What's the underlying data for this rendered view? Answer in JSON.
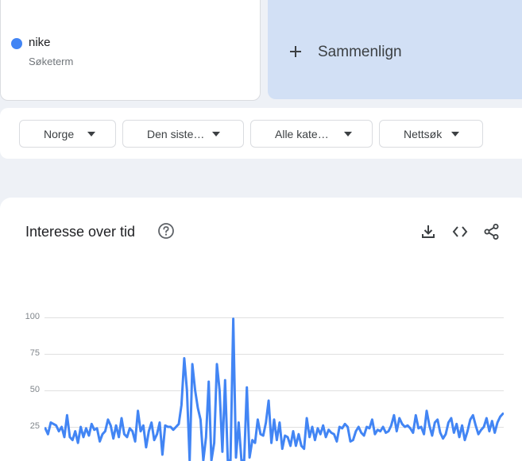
{
  "term": {
    "name": "nike",
    "subtitle": "Søketerm",
    "color": "#4285f4"
  },
  "compare": {
    "icon": "plus-icon",
    "label": "Sammenlign"
  },
  "filters": [
    {
      "label": "Norge",
      "icon": "caret-down-icon"
    },
    {
      "label": "Den siste…",
      "icon": "caret-down-icon"
    },
    {
      "label": "Alle kate…",
      "icon": "caret-down-icon"
    },
    {
      "label": "Nettsøk",
      "icon": "caret-down-icon"
    }
  ],
  "chart_section": {
    "title": "Interesse over tid",
    "help_icon": "help-circle-icon",
    "tools": [
      "download-icon",
      "embed-code-icon",
      "share-icon"
    ]
  },
  "chart_data": {
    "type": "line",
    "title": "",
    "xlabel": "",
    "ylabel": "",
    "ylim": [
      0,
      100
    ],
    "yticks": [
      "100",
      "75",
      "50",
      "25"
    ],
    "grid": true,
    "series": [
      {
        "name": "nike",
        "color": "#4285f4",
        "values": [
          24,
          20,
          28,
          27,
          26,
          22,
          25,
          18,
          33,
          18,
          16,
          22,
          14,
          25,
          18,
          24,
          19,
          27,
          23,
          24,
          15,
          20,
          22,
          30,
          26,
          17,
          26,
          18,
          31,
          20,
          18,
          24,
          22,
          15,
          36,
          22,
          26,
          11,
          22,
          28,
          16,
          20,
          28,
          6,
          26,
          25,
          25,
          23,
          25,
          27,
          40,
          72,
          50,
          2,
          68,
          50,
          38,
          30,
          2,
          18,
          56,
          2,
          14,
          68,
          50,
          8,
          57,
          2,
          2,
          99,
          4,
          28,
          2,
          2,
          52,
          4,
          16,
          14,
          30,
          20,
          19,
          28,
          43,
          14,
          30,
          16,
          28,
          10,
          19,
          18,
          12,
          22,
          12,
          20,
          12,
          10,
          31,
          18,
          25,
          16,
          24,
          20,
          26,
          18,
          23,
          21,
          20,
          15,
          25,
          24,
          27,
          25,
          15,
          16,
          22,
          25,
          21,
          19,
          25,
          24,
          30,
          20,
          23,
          22,
          25,
          21,
          22,
          26,
          33,
          22,
          31,
          27,
          25,
          26,
          24,
          21,
          33,
          24,
          25,
          20,
          36,
          26,
          19,
          28,
          30,
          21,
          17,
          20,
          28,
          31,
          21,
          27,
          18,
          26,
          16,
          22,
          30,
          33,
          26,
          20,
          23,
          25,
          31,
          22,
          29,
          21,
          28,
          32,
          34
        ]
      }
    ]
  }
}
